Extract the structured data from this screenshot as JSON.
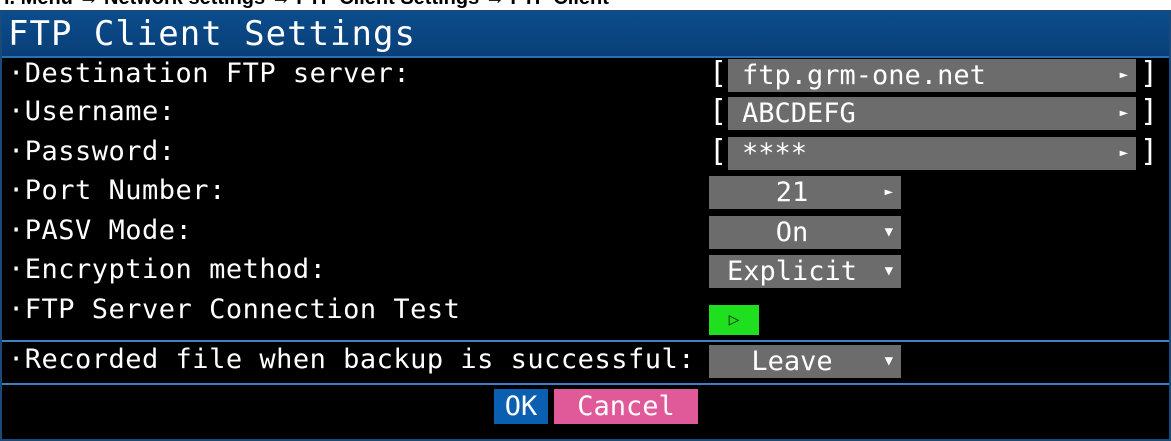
{
  "breadcrumb": "i. Menu → Network settings → FTP Client Settings → FTP Client",
  "window": {
    "title": "FTP Client Settings"
  },
  "settings": [
    {
      "label": "·Destination FTP server:",
      "value": "ftp.grm-one.net"
    },
    {
      "label": "·Username:",
      "value": "ABCDEFG"
    },
    {
      "label": "·Password:",
      "value": "****"
    },
    {
      "label": "·Port Number:",
      "value": "21"
    },
    {
      "label": "·PASV Mode:",
      "value": "On"
    },
    {
      "label": "·Encryption method:",
      "value": "Explicit"
    },
    {
      "label": "·FTP Server Connection Test",
      "value": "▷"
    },
    {
      "label": "·Recorded file when backup is successful:",
      "value": "Leave"
    }
  ],
  "icons": {
    "right_arrow": "►",
    "down_arrow": "▼",
    "bracket_open": "[",
    "bracket_close": "]"
  },
  "buttons": {
    "ok": "OK",
    "cancel": "Cancel"
  },
  "colors": {
    "title_bg": "#0b4c8c",
    "field_bg": "#6c6c6c",
    "test_button": "#1fe01f",
    "ok_button": "#0b5fb0",
    "cancel_button": "#e05a9a"
  }
}
